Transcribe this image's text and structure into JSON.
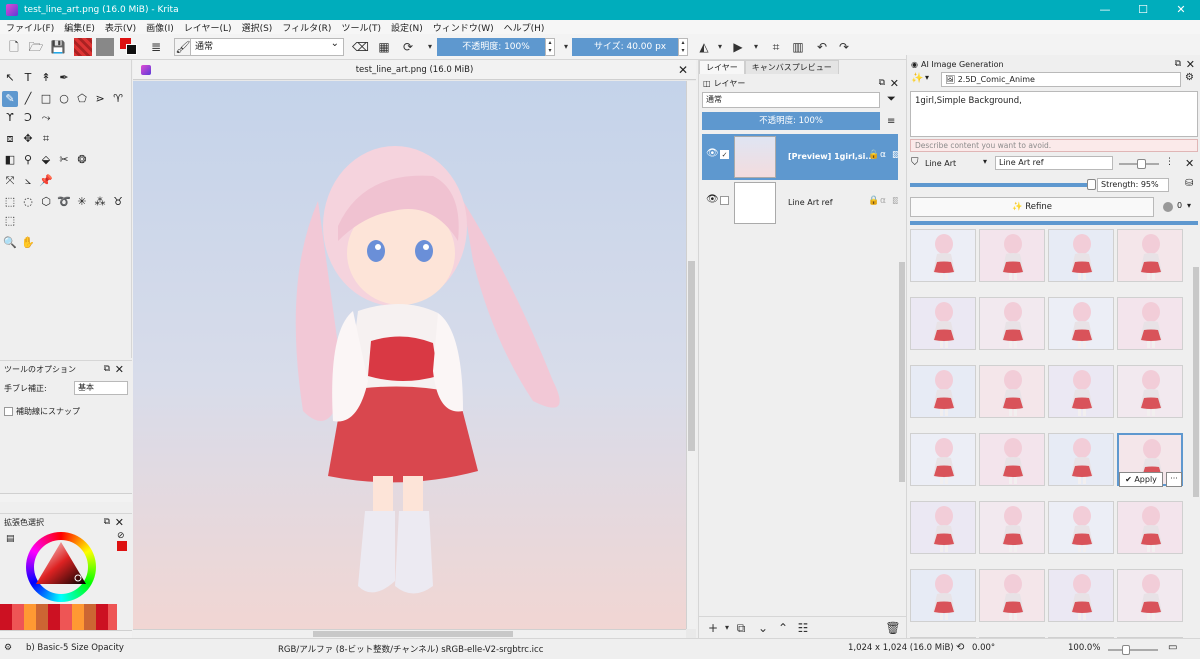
{
  "window": {
    "title": "test_line_art.png (16.0 MiB)  - Krita",
    "controls": [
      "—",
      "☐",
      "✕"
    ]
  },
  "menu": [
    "ファイル(F)",
    "編集(E)",
    "表示(V)",
    "画像(I)",
    "レイヤー(L)",
    "選択(S)",
    "フィルタ(R)",
    "ツール(T)",
    "設定(N)",
    "ウィンドウ(W)",
    "ヘルプ(H)"
  ],
  "toolbar": {
    "blend_mode": "通常",
    "opacity_label": "不透明度: 100%",
    "size_label": "サイズ: 40.00 px"
  },
  "tool_options": {
    "title": "ツールのオプション",
    "stabilizer_label": "手ブレ補正:",
    "stabilizer_value": "基本",
    "snap_label": "補助線にスナップ"
  },
  "color_selector": {
    "title": "拡張色選択"
  },
  "document": {
    "tab_title": "test_line_art.png (16.0 MiB)"
  },
  "layers_panel": {
    "tabs": [
      "レイヤー",
      "キャンバスプレビュー"
    ],
    "title": "レイヤー",
    "blend_mode": "通常",
    "opacity": "不透明度:  100%",
    "layers": [
      {
        "name": "[Preview] 1girl,si...",
        "selected": true
      },
      {
        "name": "Line Art ref",
        "selected": false
      }
    ]
  },
  "ai_panel": {
    "title": "AI Image Generation",
    "style": "2.5D_Comic_Anime",
    "prompt": "1girl,Simple Background,",
    "negative_placeholder": "Describe content you want to avoid.",
    "control_type": "Line Art",
    "control_source": "Line Art ref",
    "strength_label": "Strength: 95%",
    "refine_label": "Refine",
    "seed_count": "0",
    "apply_label": "Apply",
    "more_label": "···"
  },
  "statusbar": {
    "brush": "b) Basic-5 Size Opacity",
    "colorspace": "RGB/アルファ (8-ビット整数/チャンネル)  sRGB-elle-V2-srgbtrc.icc",
    "dimensions": "1,024 x 1,024 (16.0 MiB)",
    "rotation": "0.00°",
    "zoom": "100.0%"
  },
  "colors": {
    "accent": "#5e98cf",
    "titlebar": "#00adbc"
  }
}
